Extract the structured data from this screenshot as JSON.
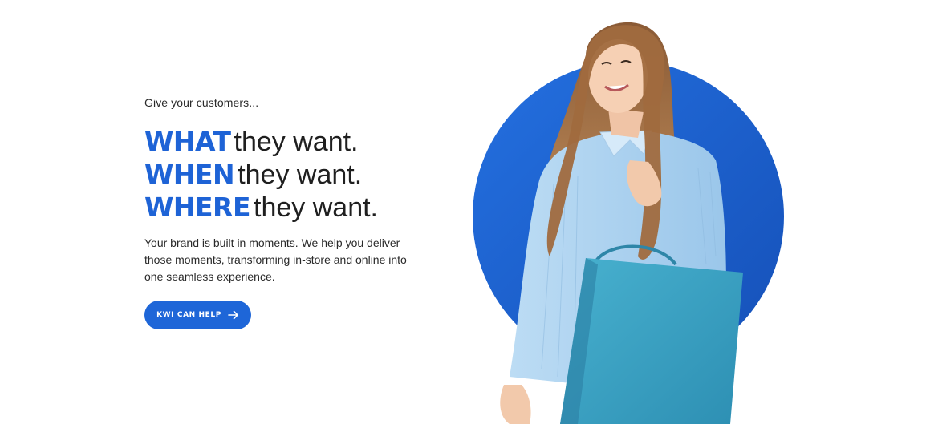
{
  "hero": {
    "eyebrow": "Give your customers...",
    "headline": [
      {
        "keyword": "WHAT",
        "rest": "they want."
      },
      {
        "keyword": "WHEN",
        "rest": "they want."
      },
      {
        "keyword": "WHERE",
        "rest": "they want."
      }
    ],
    "body": "Your brand is built in moments. We help you deliver those moments, transforming in-store and online into one seamless experience.",
    "cta_label": "KWI CAN HELP",
    "cta_icon": "arrow-right-icon"
  },
  "colors": {
    "accent": "#1e63d6",
    "circle": "#1c5fd0",
    "bag": "#3fa3c4",
    "shirt": "#a9d0ee"
  }
}
